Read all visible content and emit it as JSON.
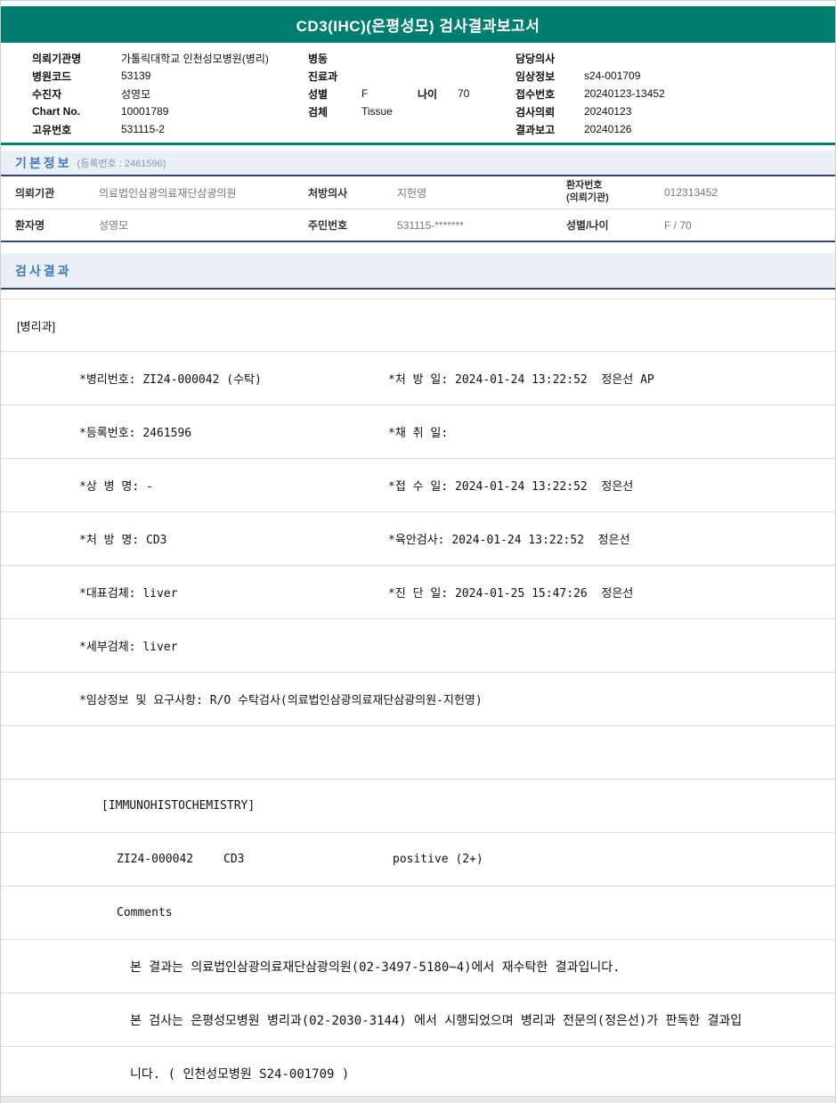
{
  "report": {
    "title": "CD3(IHC)(은평성모) 검사결과보고서"
  },
  "patient_header": {
    "left": [
      {
        "label": "의뢰기관명",
        "value": "가톨릭대학교 인천성모병원(병리)"
      },
      {
        "label": "병원코드",
        "value": "53139"
      },
      {
        "label": "수진자",
        "value": "성영모"
      },
      {
        "label": "Chart No.",
        "value": "10001789"
      },
      {
        "label": "고유번호",
        "value": "531115-2"
      }
    ],
    "middle": {
      "ward_label": "병동",
      "ward_value": "",
      "dept_label": "진료과",
      "dept_value": "",
      "sex_label": "성별",
      "sex_value": "F",
      "age_label": "나이",
      "age_value": "70",
      "specimen_label": "검체",
      "specimen_value": "Tissue"
    },
    "right": [
      {
        "label": "담당의사",
        "value": ""
      },
      {
        "label": "임상정보",
        "value": "s24-001709"
      },
      {
        "label": "접수번호",
        "value": "20240123-13452"
      },
      {
        "label": "검사의뢰",
        "value": "20240123"
      },
      {
        "label": "결과보고",
        "value": "20240126"
      }
    ]
  },
  "basic_info": {
    "title": "기본정보",
    "reg_no": "(등록번호 : 2461596)",
    "row1": {
      "l1": "의뢰기관",
      "v1": "의료법인삼광의료재단삼광의원",
      "l2": "처방의사",
      "v2": "지헌영",
      "l3": "환자번호",
      "l3b": "(의뢰기관)",
      "v3": "012313452"
    },
    "row2": {
      "l1": "환자명",
      "v1": "성영모",
      "l2": "주민번호",
      "v2": "531115-*******",
      "l3": "성별/나이",
      "v3": "F / 70"
    }
  },
  "results": {
    "title": "검사결과",
    "department": "[병리과]",
    "detail_rows": [
      {
        "left": "*병리번호: ZI24-000042 (수탁)",
        "right": "*처 방 일: 2024-01-24 13:22:52  정은선 AP"
      },
      {
        "left": "*등록번호: 2461596",
        "right": "*채 취 일:"
      },
      {
        "left": "*상 병 명: -",
        "right": "*접 수 일: 2024-01-24 13:22:52  정은선"
      },
      {
        "left": "*처 방 명: CD3",
        "right": "*육안검사: 2024-01-24 13:22:52  정은선"
      },
      {
        "left": "*대표검체: liver",
        "right": "*진 단 일: 2024-01-25 15:47:26  정은선"
      },
      {
        "left": "*세부검체: liver",
        "right": ""
      },
      {
        "left": "*임상정보 및 요구사항: R/O 수탁검사(의료법인삼광의료재단삼광의원-지헌영)",
        "right": ""
      }
    ],
    "immuno_header": "[IMMUNOHISTOCHEMISTRY]",
    "stain_row": {
      "specimen_no": "ZI24-000042",
      "stain": "CD3",
      "result": "positive (2+)"
    },
    "comments_label": "Comments",
    "comment_lines": [
      "본 결과는 의료법인삼광의료재단삼광의원(02-3497-5180~4)에서 재수탁한 결과입니다.",
      "본 검사는 은평성모병원 병리과(02-2030-3144) 에서 시행되었으며 병리과 전문의(정은선)가 판독한 결과입",
      "니다. ( 인천성모병원 S24-001709 )"
    ]
  },
  "colors": {
    "header_teal": "#007d6f",
    "section_bg": "#eaf0f6",
    "section_title_blue": "#4479b2",
    "section_border_navy": "#35426f"
  }
}
